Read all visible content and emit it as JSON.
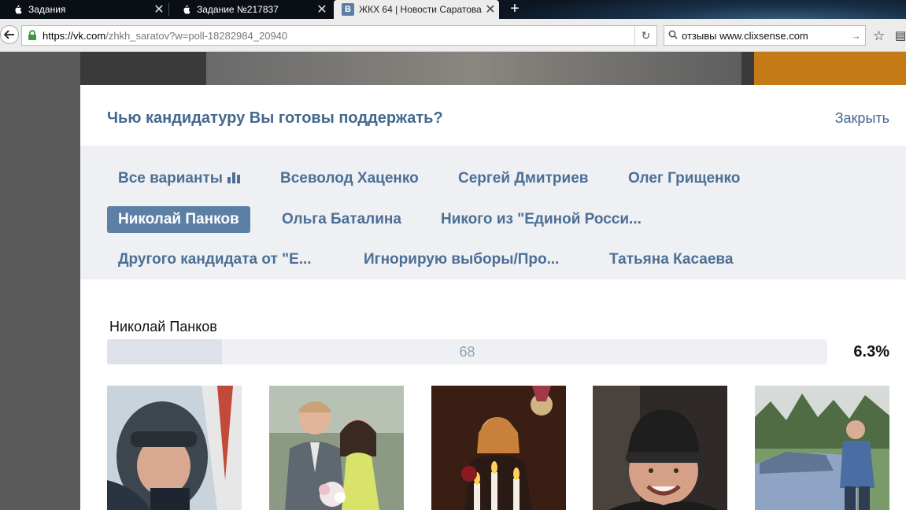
{
  "browser": {
    "tabs": [
      {
        "title": "Задания",
        "active": false
      },
      {
        "title": "Задание №217837",
        "active": false
      },
      {
        "title": "ЖКХ 64 | Новости Саратова",
        "favicon": "В",
        "active": true
      }
    ],
    "url": {
      "secure_host": "https://vk.com",
      "path": "/zhkh_saratov?w=poll-18282984_20940"
    },
    "search": {
      "value": "отзывы www.clixsense.com"
    },
    "colors": {
      "accent": "#45688e",
      "selected": "#5c7fa6"
    }
  },
  "poll": {
    "question": "Чью кандидатуру Вы готовы поддержать?",
    "close_label": "Закрыть",
    "options": [
      {
        "label": "Все варианты",
        "icon": "bar-chart-icon",
        "selected": false
      },
      {
        "label": "Всеволод Хаценко",
        "selected": false
      },
      {
        "label": "Сергей Дмитриев",
        "selected": false
      },
      {
        "label": "Олег Грищенко",
        "selected": false
      },
      {
        "label": "Николай Панков",
        "selected": true
      },
      {
        "label": "Ольга Баталина",
        "selected": false
      },
      {
        "label": "Никого из \"Единой Росси...",
        "selected": false
      },
      {
        "label": "Другого кандидата от \"Е...",
        "selected": false
      },
      {
        "label": "Игнорирую выборы/Про...",
        "selected": false
      },
      {
        "label": "Татьяна Касаева",
        "selected": false
      }
    ],
    "result": {
      "name": "Николай Панков",
      "count": "68",
      "percent": "6.3%",
      "fill_fraction": 0.16
    },
    "voters": [
      {
        "icon": "avatar-pilot"
      },
      {
        "icon": "avatar-couple"
      },
      {
        "icon": "avatar-woman-candles"
      },
      {
        "icon": "avatar-man-hat"
      },
      {
        "icon": "avatar-man-car"
      }
    ]
  }
}
